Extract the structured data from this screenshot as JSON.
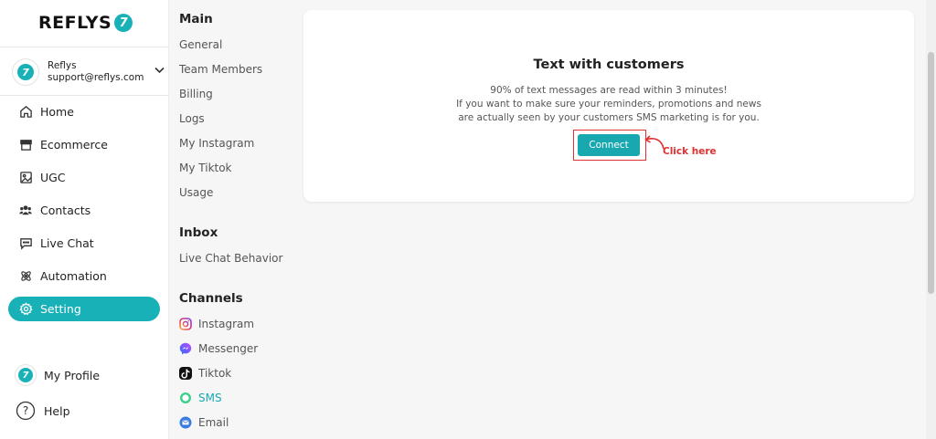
{
  "brand": {
    "name": "REFLYS",
    "mark": "7",
    "accent": "#19b1b8",
    "highlight": "#e03131"
  },
  "account": {
    "name": "Reflys",
    "email": "support@reflys.com",
    "chevron": "chevron-down-icon"
  },
  "nav": [
    {
      "label": "Home",
      "icon": "home-icon"
    },
    {
      "label": "Ecommerce",
      "icon": "store-icon"
    },
    {
      "label": "UGC",
      "icon": "image-icon"
    },
    {
      "label": "Contacts",
      "icon": "users-icon"
    },
    {
      "label": "Live Chat",
      "icon": "chat-icon"
    },
    {
      "label": "Automation",
      "icon": "atom-icon"
    },
    {
      "label": "Setting",
      "icon": "gear-icon",
      "active": true
    }
  ],
  "bottom": {
    "profile": "My Profile",
    "help": "Help"
  },
  "settings": {
    "main_heading": "Main",
    "main_items": [
      "General",
      "Team Members",
      "Billing",
      "Logs",
      "My Instagram",
      "My Tiktok",
      "Usage"
    ],
    "inbox_heading": "Inbox",
    "inbox_items": [
      "Live Chat Behavior"
    ],
    "channels_heading": "Channels",
    "channel_items": [
      {
        "label": "Instagram",
        "icon": "instagram-icon"
      },
      {
        "label": "Messenger",
        "icon": "messenger-icon"
      },
      {
        "label": "Tiktok",
        "icon": "tiktok-icon"
      },
      {
        "label": "SMS",
        "icon": "sms-icon",
        "active": true
      },
      {
        "label": "Email",
        "icon": "email-icon"
      }
    ]
  },
  "card": {
    "title": "Text with customers",
    "line1": "90% of text messages are read within 3 minutes!",
    "line2": "If you want to make sure your reminders, promotions and news",
    "line3": "are actually seen by your customers SMS marketing is for you.",
    "button": "Connect",
    "annotation": "Click here"
  }
}
